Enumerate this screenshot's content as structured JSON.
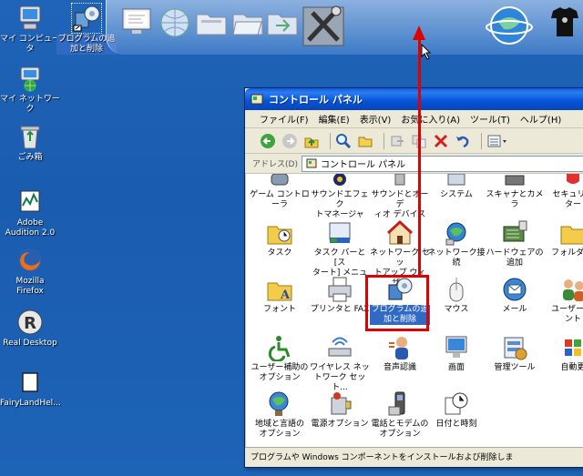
{
  "desktop": {
    "icons": [
      {
        "label": "マイ コンピュータ",
        "icon": "my-computer-icon"
      },
      {
        "label": "プログラムの追\n加と削除",
        "icon": "add-remove-programs-icon"
      },
      {
        "label": "マイ ネットワーク",
        "icon": "my-network-icon"
      },
      {
        "label": "ごみ箱",
        "icon": "recycle-bin-icon"
      },
      {
        "label": "Adobe\nAudition 2.0",
        "icon": "adobe-audition-icon"
      },
      {
        "label": "Mozilla\nFirefox",
        "icon": "firefox-icon"
      },
      {
        "label": "Real Desktop",
        "icon": "real-desktop-icon"
      },
      {
        "label": "FairyLandHel...",
        "icon": "folder-icon"
      }
    ]
  },
  "window": {
    "title": "コントロール パネル",
    "menu": [
      "ファイル(F)",
      "編集(E)",
      "表示(V)",
      "お気に入り(A)",
      "ツール(T)",
      "ヘルプ(H)"
    ],
    "address_label": "アドレス(D)",
    "address_value": "コントロール パネル",
    "status": "プログラムや Windows コンポーネントをインストールおよび削除しま"
  },
  "cp_items": [
    {
      "label": "ゲーム コントロ\nーラ"
    },
    {
      "label": "サウンドエフェク\nトマネージャ"
    },
    {
      "label": "サウンドとオーデ\nィオ デバイス"
    },
    {
      "label": "システム"
    },
    {
      "label": "スキャナとカメラ"
    },
    {
      "label": "セキュリテ\nター"
    },
    {
      "label": "タスク"
    },
    {
      "label": "タスク バーと [ス\nタート] メニュー"
    },
    {
      "label": "ネットワーク セッ\nトアップ ウィザ..."
    },
    {
      "label": "ネットワーク接\n続"
    },
    {
      "label": "ハードウェアの\n追加"
    },
    {
      "label": "フォルダ オ"
    },
    {
      "label": "フォント"
    },
    {
      "label": "プリンタと FAX"
    },
    {
      "label": "プログラムの追\n加と削除"
    },
    {
      "label": "マウス"
    },
    {
      "label": "メール"
    },
    {
      "label": "ユーザー ア\nント"
    },
    {
      "label": "ユーザー補助の\nオプション"
    },
    {
      "label": "ワイヤレス ネッ\nトワーク セット..."
    },
    {
      "label": "音声認識"
    },
    {
      "label": "画面"
    },
    {
      "label": "管理ツール"
    },
    {
      "label": "自動更"
    },
    {
      "label": "地域と言語の\nオプション"
    },
    {
      "label": "電源オプション"
    },
    {
      "label": "電話とモデムの\nオプション"
    },
    {
      "label": "日付と時刻"
    }
  ],
  "colors": {
    "desktop": "#1f64b8",
    "titlebar": "#0553d6",
    "annotation": "#e00000",
    "selection": "#316ac5"
  }
}
